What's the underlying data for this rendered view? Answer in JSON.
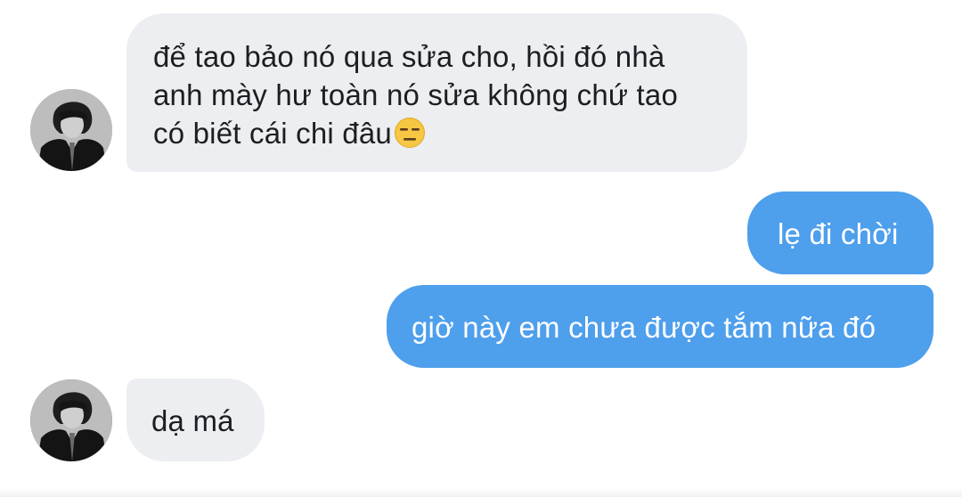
{
  "messages": [
    {
      "direction": "incoming",
      "text": "để tao bảo nó qua sửa cho, hồi đó nhà\nanh mày hư toàn nó sửa không chứ tao\ncó biết cái chi đâu",
      "emoji": "expressionless-face"
    },
    {
      "direction": "outgoing",
      "text": "lẹ đi chời"
    },
    {
      "direction": "outgoing",
      "text": "giờ này em chưa được tắm nữa đó"
    },
    {
      "direction": "incoming",
      "text": "dạ má"
    }
  ],
  "colors": {
    "incoming_bubble": "#eceef2",
    "outgoing_bubble": "#4e9fec",
    "incoming_text": "#1c1e21",
    "outgoing_text": "#ffffff"
  },
  "icons": {
    "avatar": "contact-avatar-photo",
    "emoji": "expressionless-face-emoji"
  }
}
